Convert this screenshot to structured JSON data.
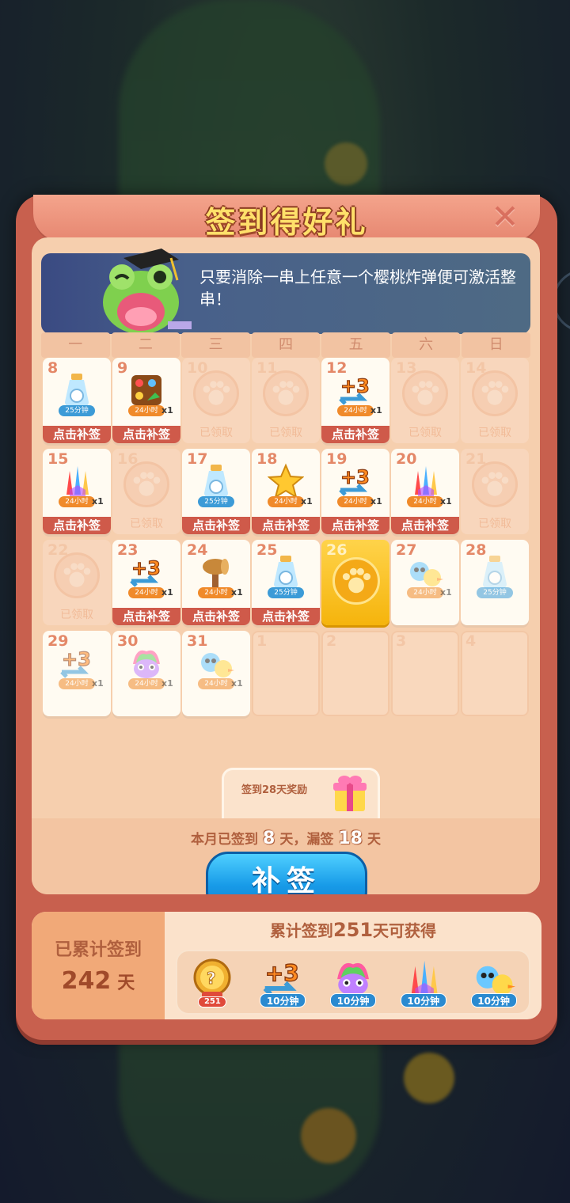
{
  "title": "签到得好礼",
  "tip": {
    "text": "只要消除一串上任意一个樱桃炸弹便可激活整串！"
  },
  "weekdays": [
    "一",
    "二",
    "三",
    "四",
    "五",
    "六",
    "日"
  ],
  "cells": [
    {
      "day": "8",
      "state": "makeup",
      "icon": "potion-icon",
      "duration": "25分钟",
      "qty": ""
    },
    {
      "day": "9",
      "state": "makeup",
      "icon": "shuffle-icon",
      "duration": "24小时",
      "qty": "x1"
    },
    {
      "day": "10",
      "state": "claimed"
    },
    {
      "day": "11",
      "state": "claimed"
    },
    {
      "day": "12",
      "state": "makeup",
      "icon": "plus3-icon",
      "duration": "24小时",
      "qty": "x1"
    },
    {
      "day": "13",
      "state": "claimed"
    },
    {
      "day": "14",
      "state": "claimed"
    },
    {
      "day": "15",
      "state": "makeup",
      "icon": "rockets-icon",
      "duration": "24小时",
      "qty": "x1"
    },
    {
      "day": "16",
      "state": "claimed"
    },
    {
      "day": "17",
      "state": "makeup",
      "icon": "potion-icon",
      "duration": "25分钟",
      "qty": ""
    },
    {
      "day": "18",
      "state": "makeup",
      "icon": "star-icon",
      "duration": "24小时",
      "qty": "x1"
    },
    {
      "day": "19",
      "state": "makeup",
      "icon": "plus3-icon",
      "duration": "24小时",
      "qty": "x1"
    },
    {
      "day": "20",
      "state": "makeup",
      "icon": "rockets-icon",
      "duration": "24小时",
      "qty": "x1"
    },
    {
      "day": "21",
      "state": "claimed"
    },
    {
      "day": "22",
      "state": "claimed"
    },
    {
      "day": "23",
      "state": "makeup",
      "icon": "plus3-icon",
      "duration": "24小时",
      "qty": "x1"
    },
    {
      "day": "24",
      "state": "makeup",
      "icon": "hammer-icon",
      "duration": "24小时",
      "qty": "x1"
    },
    {
      "day": "25",
      "state": "makeup",
      "icon": "potion-icon",
      "duration": "25分钟",
      "qty": ""
    },
    {
      "day": "26",
      "state": "today"
    },
    {
      "day": "27",
      "state": "upcoming",
      "icon": "critters-icon",
      "duration": "24小时",
      "qty": "x1"
    },
    {
      "day": "28",
      "state": "upcoming",
      "icon": "potion-icon",
      "duration": "25分钟",
      "qty": ""
    },
    {
      "day": "29",
      "state": "upcoming",
      "icon": "plus3-icon",
      "duration": "24小时",
      "qty": "x1"
    },
    {
      "day": "30",
      "state": "upcoming",
      "icon": "bird-icon",
      "duration": "24小时",
      "qty": "x1"
    },
    {
      "day": "31",
      "state": "upcoming",
      "icon": "critters-icon",
      "duration": "24小时",
      "qty": "x1"
    },
    {
      "day": "1",
      "state": "future"
    },
    {
      "day": "2",
      "state": "future"
    },
    {
      "day": "3",
      "state": "future"
    },
    {
      "day": "4",
      "state": "future"
    }
  ],
  "labels": {
    "makeup": "点击补签",
    "claimed": "已领取"
  },
  "bonus": {
    "text": "签到28天奖励"
  },
  "summary": {
    "prefix": "本月已签到",
    "signed": "8",
    "unit1": "天，漏签",
    "missed": "18",
    "unit2": "天"
  },
  "makeup_button": "补签",
  "cumulative": {
    "label": "已累计签到",
    "days": "242",
    "unit": "天",
    "goal_prefix": "累计签到",
    "goal_days": "251",
    "goal_suffix": "天可获得",
    "rewards": [
      {
        "icon": "medal-icon",
        "duration": ""
      },
      {
        "icon": "plus3-icon",
        "duration": "10分钟"
      },
      {
        "icon": "bird-icon",
        "duration": "10分钟"
      },
      {
        "icon": "rockets-icon",
        "duration": "10分钟"
      },
      {
        "icon": "critters-icon",
        "duration": "10分钟"
      }
    ],
    "medal_label": "251"
  },
  "colors": {
    "panel": "#c8604e",
    "inner": "#f6cfae",
    "makeup_bar": "#cf5a4a",
    "button_blue": "#189be8",
    "today_gold": "#f5b40c"
  }
}
